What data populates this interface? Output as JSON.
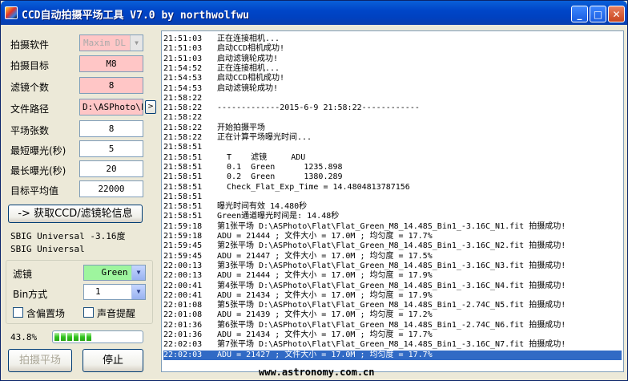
{
  "title": "CCD自动拍摄平场工具 V7.0 by northwolfwu",
  "titlebar_buttons": {
    "minimize": "_",
    "maximize": "□",
    "close": "✕"
  },
  "settings": {
    "software_label": "拍摄软件",
    "software_value": "Maxim DL",
    "target_label": "拍摄目标",
    "target_value": "M8",
    "filter_count_label": "滤镜个数",
    "filter_count_value": "8",
    "path_label": "文件路径",
    "path_value": "D:\\ASPhoto\\F",
    "browse": ">",
    "flat_count_label": "平场张数",
    "flat_count_value": "8",
    "min_exp_label": "最短曝光(秒)",
    "min_exp_value": "5",
    "max_exp_label": "最长曝光(秒)",
    "max_exp_value": "20",
    "target_mean_label": "目标平均值",
    "target_mean_value": "22000"
  },
  "get_info_button": "-> 获取CCD/滤镜轮信息",
  "ccd_info": [
    "SBIG Universal -3.16度",
    "SBIG Universal"
  ],
  "filter_label": "滤镜",
  "filter_value": "Green",
  "bin_label": "Bin方式",
  "bin_value": "1",
  "offset_label": "含偏置场",
  "sound_label": "声音提醒",
  "progress": {
    "text": "43.8%",
    "percent": 43.8
  },
  "shoot_button": "拍摄平场",
  "stop_button": "停止",
  "log": [
    [
      "21:51:03",
      "正在连接相机..."
    ],
    [
      "21:51:03",
      "启动CCD相机成功!"
    ],
    [
      "21:51:03",
      "启动滤镜轮成功!"
    ],
    [
      "21:54:52",
      "正在连接相机..."
    ],
    [
      "21:54:53",
      "启动CCD相机成功!"
    ],
    [
      "21:54:53",
      "启动滤镜轮成功!"
    ],
    [
      "21:58:22",
      ""
    ],
    [
      "21:58:22",
      "-------------2015-6-9 21:58:22------------"
    ],
    [
      "21:58:22",
      ""
    ],
    [
      "21:58:22",
      "开始拍摄平场"
    ],
    [
      "21:58:22",
      "正在计算平场曝光时间..."
    ],
    [
      "21:58:51",
      ""
    ],
    [
      "21:58:51",
      "  T    滤镜     ADU"
    ],
    [
      "21:58:51",
      "  0.1  Green      1235.898"
    ],
    [
      "21:58:51",
      "  0.2  Green      1380.289"
    ],
    [
      "21:58:51",
      "  Check_Flat_Exp_Time = 14.4804813787156"
    ],
    [
      "21:58:51",
      ""
    ],
    [
      "21:58:51",
      "曝光时间有效 14.480秒"
    ],
    [
      "21:58:51",
      "Green通道曝光时间是: 14.48秒"
    ],
    [
      "21:59:18",
      "第1张平场 D:\\ASPhoto\\Flat\\Flat_Green_M8_14.48S_Bin1_-3.16C_N1.fit 拍摄成功!"
    ],
    [
      "21:59:18",
      "ADU = 21444 ; 文件大小 = 17.0M ; 均匀度 = 17.7%"
    ],
    [
      "21:59:45",
      "第2张平场 D:\\ASPhoto\\Flat\\Flat_Green_M8_14.48S_Bin1_-3.16C_N2.fit 拍摄成功!"
    ],
    [
      "21:59:45",
      "ADU = 21447 ; 文件大小 = 17.0M ; 均匀度 = 17.5%"
    ],
    [
      "22:00:13",
      "第3张平场 D:\\ASPhoto\\Flat\\Flat_Green_M8_14.48S_Bin1_-3.16C_N3.fit 拍摄成功!"
    ],
    [
      "22:00:13",
      "ADU = 21444 ; 文件大小 = 17.0M ; 均匀度 = 17.9%"
    ],
    [
      "22:00:41",
      "第4张平场 D:\\ASPhoto\\Flat\\Flat_Green_M8_14.48S_Bin1_-3.16C_N4.fit 拍摄成功!"
    ],
    [
      "22:00:41",
      "ADU = 21434 ; 文件大小 = 17.0M ; 均匀度 = 17.9%"
    ],
    [
      "22:01:08",
      "第5张平场 D:\\ASPhoto\\Flat\\Flat_Green_M8_14.48S_Bin1_-2.74C_N5.fit 拍摄成功!"
    ],
    [
      "22:01:08",
      "ADU = 21439 ; 文件大小 = 17.0M ; 均匀度 = 17.2%"
    ],
    [
      "22:01:36",
      "第6张平场 D:\\ASPhoto\\Flat\\Flat_Green_M8_14.48S_Bin1_-2.74C_N6.fit 拍摄成功!"
    ],
    [
      "22:01:36",
      "ADU = 21434 ; 文件大小 = 17.0M ; 均匀度 = 17.7%"
    ],
    [
      "22:02:03",
      "第7张平场 D:\\ASPhoto\\Flat\\Flat_Green_M8_14.48S_Bin1_-3.16C_N7.fit 拍摄成功!"
    ],
    [
      "22:02:03",
      "ADU = 21427 ; 文件大小 = 17.0M ; 均匀度 = 17.7%"
    ]
  ],
  "selected_log_index": 32,
  "watermark": "www.astronomy.com.cn"
}
